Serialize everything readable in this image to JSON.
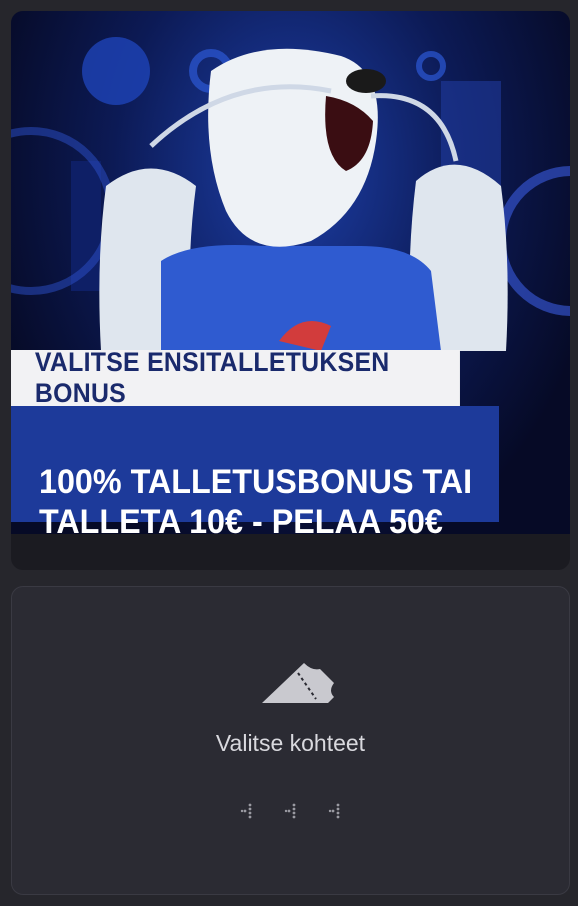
{
  "promo": {
    "subtitle": "VALITSE ENSITALLETUKSEN BONUS",
    "headline": "100% TALLETUSBONUS TAI\nTALLETA 10€ - PELAA 50€",
    "colors": {
      "banner_blue": "#1d3a9a",
      "banner_white": "#f2f2f4",
      "subtitle_text": "#1a2a6c"
    }
  },
  "selection": {
    "icon": "ticket-icon",
    "empty_label": "Valitse kohteet",
    "loader_icon": "loading-dots-icon"
  }
}
